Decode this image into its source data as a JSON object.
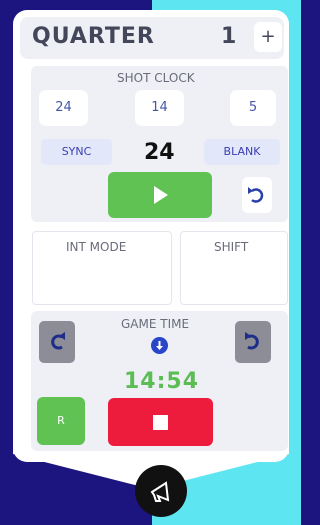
{
  "quarter": {
    "label": "QUARTER",
    "value": "1",
    "plus_label": "+"
  },
  "shot_clock": {
    "title": "SHOT CLOCK",
    "presets": [
      "24",
      "14",
      "5"
    ],
    "sync_label": "SYNC",
    "value": "24",
    "blank_label": "BLANK"
  },
  "modes": {
    "int_mode_label": "INT MODE",
    "shift_label": "SHIFT"
  },
  "game_time": {
    "title": "GAME TIME",
    "value": "14:54",
    "r_label": "R"
  },
  "icons": {
    "play": "play-icon",
    "reset": "reset-icon",
    "redo": "redo-icon",
    "undo": "undo-icon",
    "download": "arrow-down-icon",
    "stop": "stop-icon",
    "horn": "horn-icon"
  },
  "colors": {
    "green": "#61c254",
    "red": "#ee1c3c",
    "navy": "#1c1580",
    "cyan": "#5de6f2",
    "gray": "#8c8d96"
  }
}
